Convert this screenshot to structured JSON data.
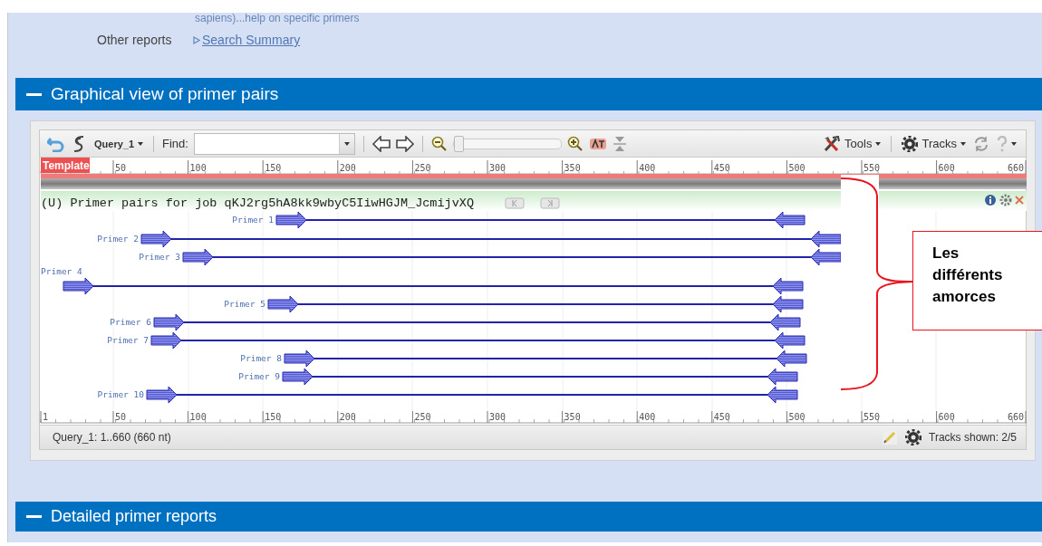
{
  "top_text": "sapiens)...help on specific primers",
  "other_reports": {
    "label": "Other reports",
    "link": "Search Summary"
  },
  "sections": [
    {
      "title": "Graphical view of primer pairs",
      "expanded": true
    },
    {
      "title": "Detailed primer reports",
      "expanded": true
    }
  ],
  "viewer": {
    "toolbar": {
      "sequence": "Query_1",
      "find_label": "Find:",
      "zoom": {
        "level": 0
      },
      "tools": "Tools",
      "tracks": "Tracks"
    },
    "ruler_top": {
      "label": "Template",
      "ticks": [
        "50",
        "100",
        "150",
        "200",
        "250",
        "300",
        "350",
        "400",
        "450",
        "500",
        "550",
        "600",
        "660"
      ]
    },
    "track": {
      "title": "(U) Primer pairs for job qKJ2rg5hA8kk9wbyC5IiwHGJM_JcmijvXQ"
    },
    "primers": [
      {
        "label": "Primer 1"
      },
      {
        "label": "Primer 2"
      },
      {
        "label": "Primer 3"
      },
      {
        "label": "Primer 4"
      },
      {
        "label": "Primer 5"
      },
      {
        "label": "Primer 6"
      },
      {
        "label": "Primer 7"
      },
      {
        "label": "Primer 8"
      },
      {
        "label": "Primer 9"
      },
      {
        "label": "Primer 10"
      }
    ],
    "ruler_bottom": {
      "ticks": [
        "1",
        "50",
        "100",
        "150",
        "200",
        "250",
        "300",
        "350",
        "400",
        "450",
        "500",
        "550",
        "600",
        "660"
      ]
    },
    "status": "Query_1: 1..660 (660 nt)",
    "tracks_shown": "Tracks shown: 2/5"
  },
  "annotation": {
    "text": "Les différents amorces"
  }
}
